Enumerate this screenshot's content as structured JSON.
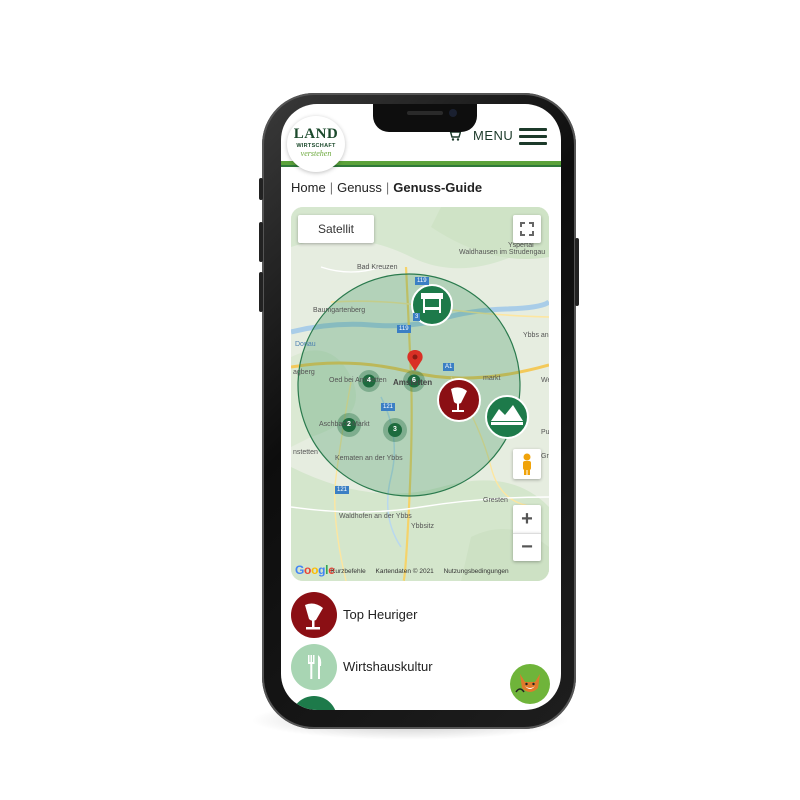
{
  "header": {
    "logo_line1": "LAND",
    "logo_line2": "WIRTSCHAFT",
    "logo_line3": "verstehen",
    "menu_label": "MENU",
    "cart_icon": "cart-icon",
    "menu_icon": "hamburger-icon"
  },
  "breadcrumb": {
    "items": [
      "Home",
      "Genuss",
      "Genuss-Guide"
    ],
    "separator": "|"
  },
  "map": {
    "satellite_label": "Satellit",
    "zoom_in_label": "+",
    "zoom_out_label": "−",
    "google_logo": "Google",
    "footer": [
      "Kurzbefehle",
      "Kartendaten © 2021",
      "Nutzungsbedingungen"
    ],
    "places": [
      "Yspertal",
      "Waldhausen im Strudengau",
      "Bad Kreuzen",
      "Baumgartenberg",
      "Ybbs an der Donau",
      "Oed bei Amstetten",
      "Amstetten",
      "markt",
      "Aschbach-Markt",
      "Kematen an der Ybbs",
      "Gresten",
      "Waldhofen an der Ybbs",
      "Ybbsitz",
      "Donau",
      "agberg",
      "nstetten",
      "Pu",
      "We",
      "Gre"
    ],
    "road_labels": [
      "119",
      "3",
      "119",
      "A1",
      "121",
      "121"
    ],
    "clusters": [
      {
        "count": "4"
      },
      {
        "count": "6"
      },
      {
        "count": "2"
      },
      {
        "count": "3"
      }
    ],
    "markers": [
      "market-stall-icon",
      "wine-glass-icon",
      "farm-landscape-icon",
      "location-pin-icon"
    ],
    "colors": {
      "radius_fill": "#2e8b57",
      "cluster": "#1d6b3e",
      "top_heuriger": "#8b0f14",
      "farm": "#1d7a4a"
    }
  },
  "legend": [
    {
      "label": "Top Heuriger",
      "icon": "wine-glass-icon",
      "color": "#8b0f14"
    },
    {
      "label": "Wirtshauskultur",
      "icon": "fork-knife-icon",
      "color": "#a8d5b3"
    },
    {
      "label": "",
      "icon": "category-icon",
      "color": "#1d7a4a"
    }
  ],
  "chat_badge": {
    "icon": "fox-icon"
  }
}
